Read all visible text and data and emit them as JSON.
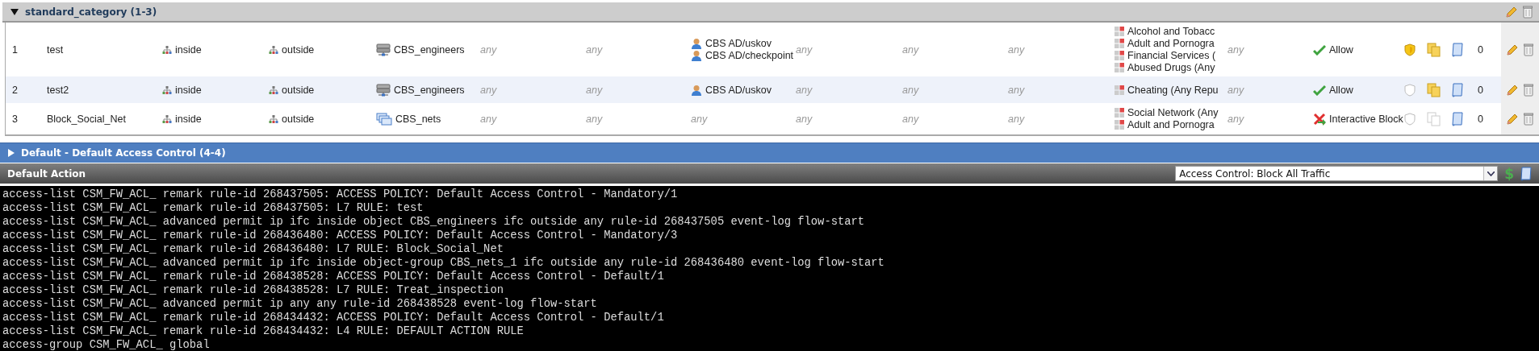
{
  "category_section": {
    "title": "standard_category (1-3)",
    "expanded": true
  },
  "rules": [
    {
      "number": "1",
      "name": "test",
      "source_zone": [
        {
          "kind": "zone",
          "label": "inside"
        }
      ],
      "destination_zone": [
        {
          "kind": "zone",
          "label": "outside"
        }
      ],
      "source_networks": [
        {
          "kind": "object",
          "label": "CBS_engineers"
        }
      ],
      "column_6": [
        {
          "kind": "any",
          "label": "any"
        }
      ],
      "column_7": [
        {
          "kind": "any",
          "label": "any"
        }
      ],
      "users": [
        {
          "kind": "user",
          "label": "CBS AD/uskov"
        },
        {
          "kind": "user",
          "label": "CBS AD/checkpoint"
        }
      ],
      "column_9": [
        {
          "kind": "any",
          "label": "any"
        }
      ],
      "column_10": [
        {
          "kind": "any",
          "label": "any"
        }
      ],
      "column_11": [
        {
          "kind": "any",
          "label": "any"
        }
      ],
      "url_categories": [
        {
          "kind": "url",
          "label": "Alcohol and Tobacc"
        },
        {
          "kind": "url",
          "label": "Adult and Pornogra"
        },
        {
          "kind": "url",
          "label": "Financial Services ("
        },
        {
          "kind": "url",
          "label": "Abused Drugs (Any"
        }
      ],
      "column_13": [
        {
          "kind": "any",
          "label": "any"
        }
      ],
      "action": {
        "kind": "allow",
        "label": "Allow"
      },
      "shield_on": true,
      "files_on": true,
      "hit_count": "0"
    },
    {
      "number": "2",
      "name": "test2",
      "source_zone": [
        {
          "kind": "zone",
          "label": "inside"
        }
      ],
      "destination_zone": [
        {
          "kind": "zone",
          "label": "outside"
        }
      ],
      "source_networks": [
        {
          "kind": "object",
          "label": "CBS_engineers"
        }
      ],
      "column_6": [
        {
          "kind": "any",
          "label": "any"
        }
      ],
      "column_7": [
        {
          "kind": "any",
          "label": "any"
        }
      ],
      "users": [
        {
          "kind": "user",
          "label": "CBS AD/uskov"
        }
      ],
      "column_9": [
        {
          "kind": "any",
          "label": "any"
        }
      ],
      "column_10": [
        {
          "kind": "any",
          "label": "any"
        }
      ],
      "column_11": [
        {
          "kind": "any",
          "label": "any"
        }
      ],
      "url_categories": [
        {
          "kind": "url",
          "label": "Cheating (Any Repu"
        }
      ],
      "column_13": [
        {
          "kind": "any",
          "label": "any"
        }
      ],
      "action": {
        "kind": "allow",
        "label": "Allow"
      },
      "shield_on": false,
      "files_on": true,
      "hit_count": "0"
    },
    {
      "number": "3",
      "name": "Block_Social_Net",
      "source_zone": [
        {
          "kind": "zone",
          "label": "inside"
        }
      ],
      "destination_zone": [
        {
          "kind": "zone",
          "label": "outside"
        }
      ],
      "source_networks": [
        {
          "kind": "group",
          "label": "CBS_nets"
        }
      ],
      "column_6": [
        {
          "kind": "any",
          "label": "any"
        }
      ],
      "column_7": [
        {
          "kind": "any",
          "label": "any"
        }
      ],
      "users": [
        {
          "kind": "any",
          "label": "any"
        }
      ],
      "column_9": [
        {
          "kind": "any",
          "label": "any"
        }
      ],
      "column_10": [
        {
          "kind": "any",
          "label": "any"
        }
      ],
      "column_11": [
        {
          "kind": "any",
          "label": "any"
        }
      ],
      "url_categories": [
        {
          "kind": "url",
          "label": "Social Network (Any"
        },
        {
          "kind": "url",
          "label": "Adult and Pornogra"
        }
      ],
      "column_13": [
        {
          "kind": "any",
          "label": "any"
        }
      ],
      "action": {
        "kind": "interactive_block",
        "label": "Interactive Block"
      },
      "shield_on": false,
      "files_on": false,
      "hit_count": "0"
    }
  ],
  "default_section": {
    "title": "Default - Default Access Control (4-4)",
    "expanded": false
  },
  "default_action": {
    "title": "Default Action",
    "value": "Access Control: Block All Traffic",
    "variable_glyph": "$"
  },
  "console_lines": [
    "access-list CSM_FW_ACL_ remark rule-id 268437505: ACCESS POLICY: Default Access Control - Mandatory/1",
    "access-list CSM_FW_ACL_ remark rule-id 268437505: L7 RULE: test",
    "access-list CSM_FW_ACL_ advanced permit ip ifc inside object CBS_engineers ifc outside any rule-id 268437505 event-log flow-start",
    "access-list CSM_FW_ACL_ remark rule-id 268436480: ACCESS POLICY: Default Access Control - Mandatory/3",
    "access-list CSM_FW_ACL_ remark rule-id 268436480: L7 RULE: Block_Social_Net",
    "access-list CSM_FW_ACL_ advanced permit ip ifc inside object-group CBS_nets_1 ifc outside any rule-id 268436480 event-log flow-start",
    "access-list CSM_FW_ACL_ remark rule-id 268438528: ACCESS POLICY: Default Access Control - Default/1",
    "access-list CSM_FW_ACL_ remark rule-id 268438528: L7 RULE: Treat_inspection",
    "access-list CSM_FW_ACL_ advanced permit ip any any rule-id 268438528 event-log flow-start",
    "access-list CSM_FW_ACL_ remark rule-id 268434432: ACCESS POLICY: Default Access Control - Default/1",
    "access-list CSM_FW_ACL_ remark rule-id 268434432: L4 RULE: DEFAULT ACTION RULE",
    "access-group CSM_FW_ACL_ global"
  ]
}
